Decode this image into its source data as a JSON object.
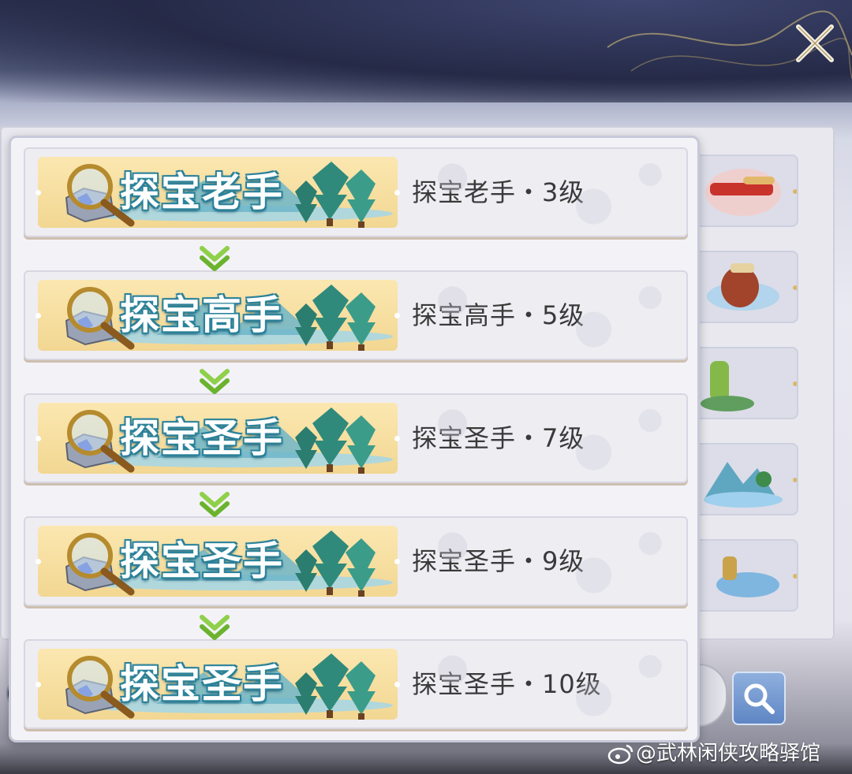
{
  "popup": {
    "ranks": [
      {
        "badge_text": "探宝老手",
        "label": "探宝老手・3级"
      },
      {
        "badge_text": "探宝高手",
        "label": "探宝高手・5级"
      },
      {
        "badge_text": "探宝圣手",
        "label": "探宝圣手・7级"
      },
      {
        "badge_text": "探宝圣手",
        "label": "探宝圣手・9级"
      },
      {
        "badge_text": "探宝圣手",
        "label": "探宝圣手・10级"
      }
    ]
  },
  "watermark": {
    "text": "@武林闲侠攻略驿馆"
  },
  "buttons": {
    "warn_symbol": "!"
  },
  "icons": {
    "close": "close-icon",
    "search": "search-icon",
    "magnifier": "magnifier-icon",
    "arrow": "chevron-down-icon",
    "weibo": "weibo-icon"
  },
  "colors": {
    "badge_bg": "#f2d792",
    "title_text": "#3a3a3a",
    "arrow_green": "#7ccb3a",
    "search_button": "#5f86c4"
  }
}
